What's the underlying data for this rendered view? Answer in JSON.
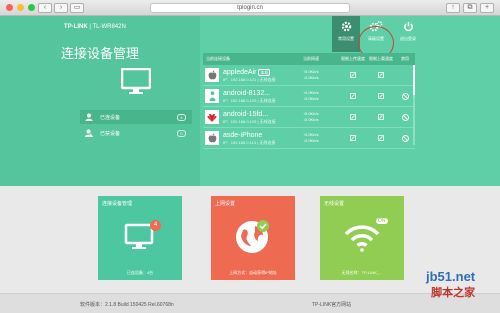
{
  "browser": {
    "url": "tplogin.cn"
  },
  "brand": {
    "logo": "TP-LINK",
    "model": "TL-WR842N"
  },
  "page": {
    "title": "连接设备管理"
  },
  "sidebar": {
    "items": [
      {
        "label": "已连设备",
        "count": "4"
      },
      {
        "label": "已禁设备",
        "count": "0"
      }
    ]
  },
  "toolbar": {
    "items": [
      {
        "label": "常用设置"
      },
      {
        "label": "高级设置"
      },
      {
        "label": "退出登录"
      }
    ]
  },
  "table": {
    "headers": [
      "当前连接设备",
      "当前网速",
      "限制上传速度",
      "限制上载速度",
      "禁用"
    ],
    "rows": [
      {
        "name": "appledeAir",
        "tag": "本机",
        "ip": "IP：192.168.0.121 | 无线连接",
        "up": "↑0.0Kb/s",
        "down": "↓0.0Kb/s"
      },
      {
        "name": "android-8132...",
        "tag": "",
        "ip": "IP：192.168.0.103 | 无线连接",
        "up": "↑0.0Kb/s",
        "down": "↓0.0Kb/s"
      },
      {
        "name": "android-15fd...",
        "tag": "",
        "ip": "IP：192.168.0.125 | 无线连接",
        "up": "↑0.0Kb/s",
        "down": "↓0.0Kb/s"
      },
      {
        "name": "asde-iPhone",
        "tag": "",
        "ip": "IP：192.168.0.113 | 无线连接",
        "up": "↑0.0Kb/s",
        "down": "↓0.0Kb/s"
      }
    ]
  },
  "cards": {
    "devices": {
      "title": "连接设备管理",
      "footer": "已连设备：4台",
      "badge": "4"
    },
    "network": {
      "title": "上网设置",
      "footer": "上网方式：自动获得IP地址"
    },
    "wifi": {
      "title": "无线设置",
      "footer": "无线名称：TP-LINK_...",
      "badge": "ON"
    }
  },
  "footer": {
    "version": "软件版本：2.1.8 Build 150425 Rel.60768n",
    "right": "TP-LINK官方网站"
  },
  "watermark": {
    "line1": "jb51.net",
    "line2": "脚本之家"
  },
  "colors": {
    "accent": "#5ecfa7",
    "dark": "#3b8f70",
    "network": "#ee6a51",
    "wifi": "#90cd52",
    "highlight": "#c8443a"
  }
}
